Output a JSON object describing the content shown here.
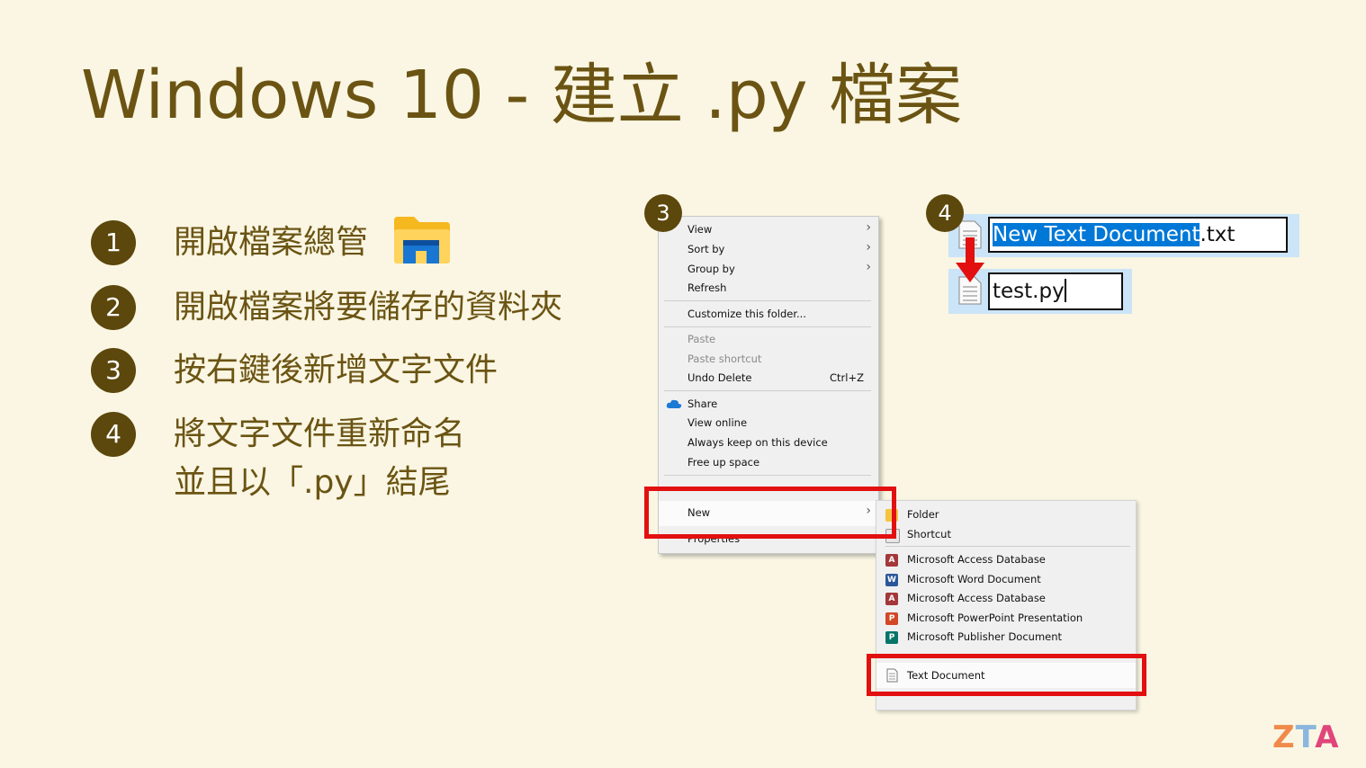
{
  "title": "Windows 10 - 建立 .py 檔案",
  "steps": [
    {
      "num": "1",
      "text": "開啟檔案總管"
    },
    {
      "num": "2",
      "text": "開啟檔案將要儲存的資料夾"
    },
    {
      "num": "3",
      "text": "按右鍵後新增文字文件"
    },
    {
      "num": "4",
      "text": "將文字文件重新命名",
      "text2": "並且以「.py」結尾"
    }
  ],
  "badges": {
    "ctx": "3",
    "rename": "4"
  },
  "context_menu": {
    "view": "View",
    "sort_by": "Sort by",
    "group_by": "Group by",
    "refresh": "Refresh",
    "customize": "Customize this folder...",
    "paste": "Paste",
    "paste_shortcut": "Paste shortcut",
    "undo_delete": "Undo Delete",
    "undo_shortcut": "Ctrl+Z",
    "share": "Share",
    "view_online": "View online",
    "always_keep": "Always keep on this device",
    "free_up": "Free up space",
    "new": "New",
    "properties": "Properties"
  },
  "submenu": {
    "folder": "Folder",
    "shortcut": "Shortcut",
    "access1": "Microsoft Access Database",
    "word": "Microsoft Word Document",
    "access2": "Microsoft Access Database",
    "powerpoint": "Microsoft PowerPoint Presentation",
    "publisher": "Microsoft Publisher Document",
    "text_document": "Text Document"
  },
  "rename": {
    "selected": "New Text Document",
    "ext": ".txt",
    "new_name": "test.py"
  },
  "logo": {
    "z": "Z",
    "t": "T",
    "a": "A"
  },
  "colors": {
    "accent": "#5c470c",
    "text": "#6b5413",
    "highlight": "#e21010",
    "selection": "#0078d7"
  }
}
